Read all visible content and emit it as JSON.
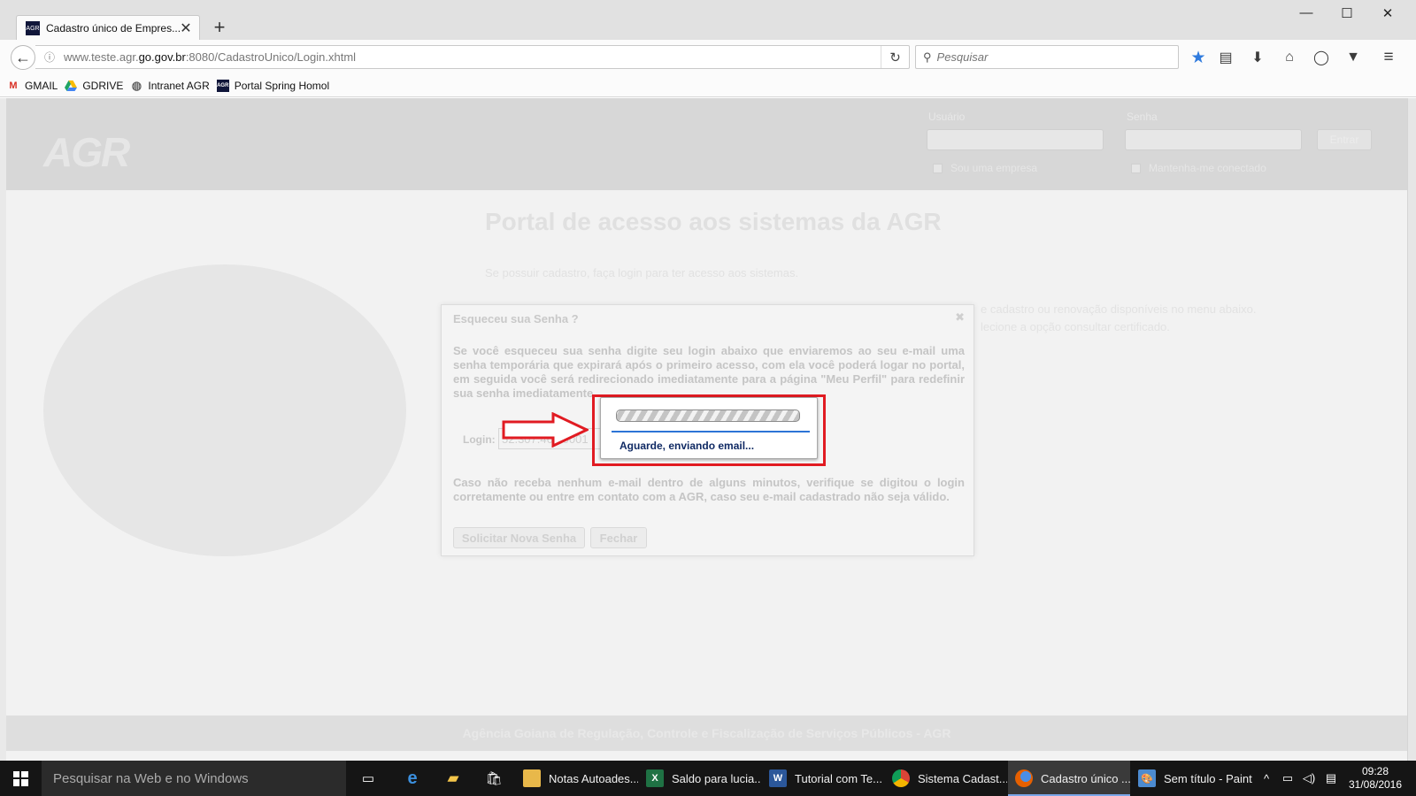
{
  "browser": {
    "tab_title": "Cadastro único de Empres...",
    "tab_favicon_text": "AGR",
    "url_prefix": "www.teste.agr.",
    "url_domain": "go.gov.br",
    "url_suffix": ":8080/CadastroUnico/Login.xhtml",
    "search_placeholder": "Pesquisar",
    "bookmarks": [
      {
        "label": "GMAIL",
        "icon": "gmail-icon"
      },
      {
        "label": "GDRIVE",
        "icon": "gdrive-icon"
      },
      {
        "label": "Intranet AGR",
        "icon": "globe-icon"
      },
      {
        "label": "Portal Spring Homol",
        "icon": "agr-icon"
      }
    ]
  },
  "page": {
    "logo": "AGR",
    "header": {
      "usuario_label": "Usuário",
      "senha_label": "Senha",
      "entrar_label": "Entrar",
      "sou_empresa": "Sou uma empresa",
      "manter_conectado": "Mantenha-me conectado"
    },
    "title": "Portal de acesso aos sistemas da AGR",
    "subtitle": "Se possuir cadastro, faça login para ter acesso aos sistemas.",
    "bg_line_1": "e cadastro ou renovação disponíveis no menu abaixo.",
    "bg_line_2": "lecione a opção consultar certificado.",
    "footer": "Agência Goiana de Regulação, Controle e Fiscalização de Serviços Públicos - AGR"
  },
  "dialog": {
    "title": "Esqueceu sua Senha ?",
    "paragraph_1": "Se você esqueceu sua senha digite seu login abaixo que enviaremos ao seu e-mail uma senha temporária que expirará após o primeiro acesso, com ela você poderá logar no portal, em seguida você será redirecionado imediatamente para a página \"Meu Perfil\" para redefinir sua senha imediatamente.",
    "login_label": "Login:",
    "login_value": "52.307.466/0001",
    "paragraph_2": "Caso não receba nenhum e-mail dentro de alguns minutos, verifique se digitou o login corretamente ou entre em contato com a AGR, caso seu e-mail cadastrado não seja válido.",
    "btn_solicitar": "Solicitar Nova Senha",
    "btn_fechar": "Fechar"
  },
  "loading": {
    "message": "Aguarde, enviando email..."
  },
  "taskbar": {
    "search_placeholder": "Pesquisar na Web e no Windows",
    "items": [
      {
        "label": "Notas Autoades...",
        "icon": "folder-notes-icon",
        "color": "#e8b84a"
      },
      {
        "label": "Saldo para lucia...",
        "icon": "excel-icon",
        "color": "#1f7244"
      },
      {
        "label": "Tutorial com Te...",
        "icon": "word-icon",
        "color": "#2b579a"
      },
      {
        "label": "Sistema Cadast...",
        "icon": "chrome-icon",
        "color": "#db4437"
      },
      {
        "label": "Cadastro único ...",
        "icon": "firefox-icon",
        "color": "#e66000"
      },
      {
        "label": "Sem título - Paint",
        "icon": "paint-icon",
        "color": "#4c8bd0"
      }
    ],
    "time": "09:28",
    "date": "31/08/2016"
  },
  "colors": {
    "highlight": "#e11b22",
    "taskbar_bg": "#151515"
  }
}
